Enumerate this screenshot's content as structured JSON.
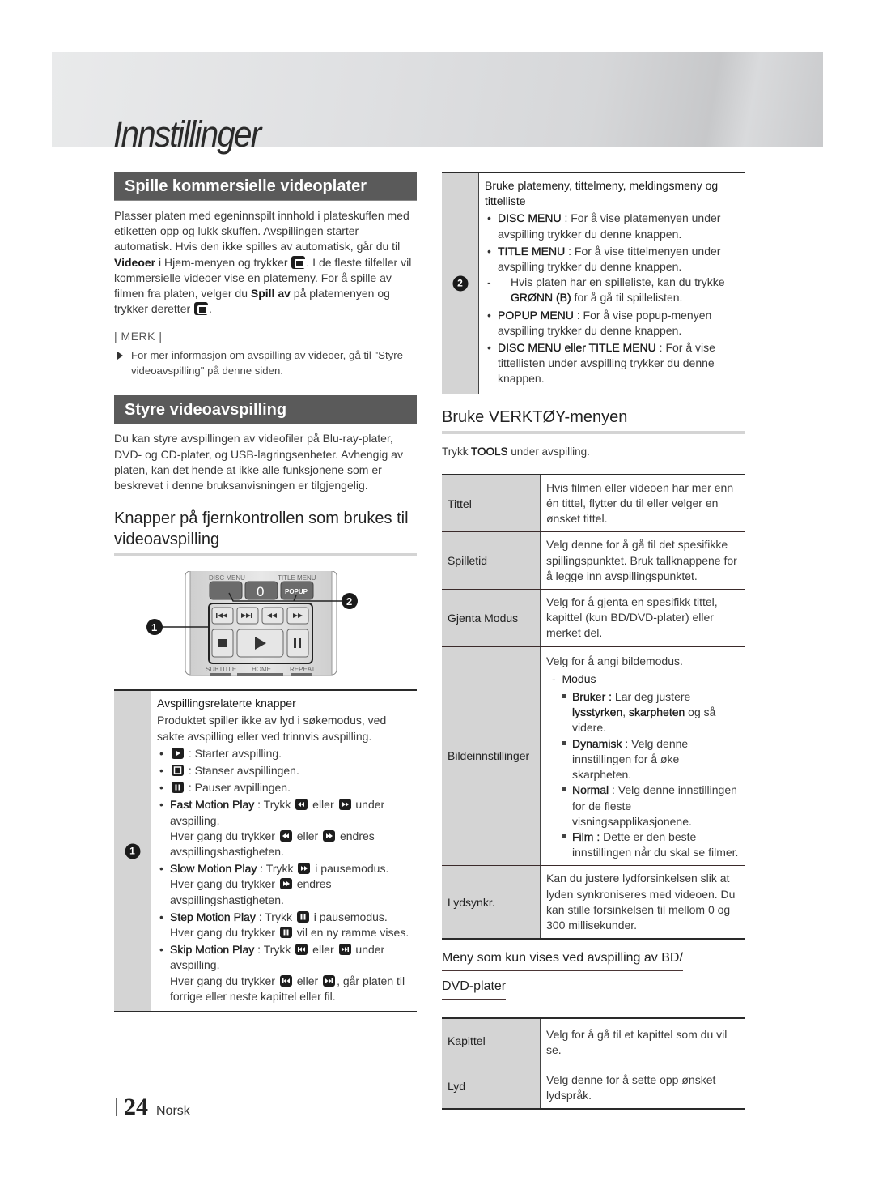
{
  "page": {
    "title": "Innstillinger",
    "page_number": "24",
    "language": "Norsk"
  },
  "left": {
    "section1": {
      "heading": "Spille kommersielle videoplater",
      "para": [
        {
          "t": "Plasser platen med egeninnspilt innhold i plateskuffen med etiketten opp og lukk skuffen. Avspillingen starter automatisk. Hvis den ikke spilles av automatisk, går du til "
        },
        {
          "b": "Videoer"
        },
        {
          "t": " i Hjem-menyen og trykker "
        },
        {
          "icon": "enter"
        },
        {
          "t": ". I de fleste tilfeller vil kommersielle videoer vise en platemeny. For å spille av filmen fra platen, velger du "
        },
        {
          "b": "Spill av"
        },
        {
          "t": " på platemenyen og trykker deretter "
        },
        {
          "icon": "enter"
        },
        {
          "t": "."
        }
      ],
      "merk_label": "| MERK |",
      "note": "For mer informasjon om avspilling av videoer, gå til \"Styre videoavspilling\" på denne siden."
    },
    "section2": {
      "heading": "Styre videoavspilling",
      "para": "Du kan styre avspillingen av videofiler på Blu-ray-plater, DVD- og CD-plater, og USB-lagringsenheter. Avhengig av platen, kan det hende at ikke alle funksjonene som er beskrevet i denne bruksanvisningen er tilgjengelig.",
      "subheading": "Knapper på fjernkontrollen som brukes til videoavspilling"
    },
    "remote": {
      "labels": {
        "disc_menu": "DISC MENU",
        "title_menu": "TITLE MENU",
        "zero": "0",
        "popup": "POPUP",
        "subtitle": "SUBTITLE",
        "home": "HOME",
        "repeat": "REPEAT"
      },
      "callout1": "1",
      "callout2": "2"
    },
    "table": {
      "num": "1",
      "title": "Avspillingsrelaterte knapper",
      "intro": "Produktet spiller ikke av lyd i søkemodus, ved sakte avspilling eller ved trinnvis avspilling.",
      "play": ": Starter avspilling.",
      "stop": ": Stanser avspillingen.",
      "pause": ": Pauser avpillingen.",
      "fast": {
        "name": "Fast Motion Play",
        "a": " : Trykk ",
        "b": " eller ",
        "c": " under avspilling.",
        "d": "Hver gang du trykker ",
        "e": " eller ",
        "f": " endres avspillingshastigheten."
      },
      "slow": {
        "name": "Slow Motion Play",
        "a": " : Trykk ",
        "b": " i pausemodus.",
        "c": "Hver gang du trykker ",
        "d": " endres avspillingshastigheten."
      },
      "step": {
        "name": "Step Motion Play",
        "a": " : Trykk ",
        "b": " i pausemodus.",
        "c": "Hver gang du trykker ",
        "d": " vil en ny ramme vises."
      },
      "skip": {
        "name": "Skip Motion Play",
        "a": " : Trykk ",
        "b": " eller ",
        "c": " under avspilling.",
        "d": "Hver gang du trykker ",
        "e": " eller ",
        "f": ", går platen til forrige eller neste kapittel eller fil."
      }
    }
  },
  "right": {
    "table2": {
      "num": "2",
      "title": "Bruke platemeny, tittelmeny, meldingsmeny og tittelliste",
      "disc": {
        "name": "DISC MENU",
        "text": " : For å vise platemenyen under avspilling trykker du denne knappen."
      },
      "titlemenu": {
        "name": "TITLE MENU",
        "text": " : For å vise tittelmenyen under avspilling trykker du denne knappen."
      },
      "sub": {
        "a": "Hvis platen har en spilleliste, kan du trykke ",
        "b": "GRØNN (B)",
        "c": " for å gå til spillelisten."
      },
      "popup": {
        "name": "POPUP MENU",
        "text": " : For å vise popup-menyen avspilling trykker du denne knappen."
      },
      "either": {
        "name": "DISC MENU eller TITLE MENU",
        "text": " : For å vise tittellisten under avspilling trykker du denne knappen."
      }
    },
    "tools": {
      "heading": "Bruke VERKTØY-menyen",
      "intro_a": "Trykk ",
      "intro_b": "TOOLS",
      "intro_c": " under avspilling.",
      "rows": [
        {
          "label": "Tittel",
          "desc": "Hvis filmen eller videoen har mer enn én tittel, flytter du til eller velger en ønsket tittel."
        },
        {
          "label": "Spilletid",
          "desc": "Velg denne for å gå til det spesifikke spillingspunktet. Bruk tallknappene for å legge inn avspillingspunktet."
        },
        {
          "label": "Gjenta Modus",
          "desc": "Velg for å gjenta en spesifikk tittel, kapittel (kun BD/DVD-plater) eller merket del."
        }
      ],
      "picture": {
        "label": "Bildeinnstillinger",
        "intro": "Velg for å angi bildemodus.",
        "modus": "Modus",
        "bruker": {
          "name": "Bruker :",
          "a": " Lar deg justere ",
          "b": "lysstyrken",
          "c": ", ",
          "d": "skarpheten",
          "e": " og så videre."
        },
        "dynamisk": {
          "name": "Dynamisk",
          "text": " : Velg denne innstillingen for å øke skarpheten."
        },
        "normal": {
          "name": "Normal",
          "text": " : Velg denne innstillingen for de fleste visningsapplikasjonene."
        },
        "film": {
          "name": "Film :",
          "text": " Dette er den beste innstillingen når du skal se filmer."
        }
      },
      "lydsynkr": {
        "label": "Lydsynkr.",
        "desc": "Kan du justere lydforsinkelsen slik at lyden synkroniseres med videoen. Du kan stille forsinkelsen til mellom 0 og 300 millisekunder."
      }
    },
    "bd": {
      "heading_line1": "Meny som kun vises ved avspilling av BD/",
      "heading_line2": "DVD-plater",
      "rows": [
        {
          "label": "Kapittel",
          "desc": "Velg for å gå til et kapittel som du vil se."
        },
        {
          "label": "Lyd",
          "desc": "Velg denne for å sette opp ønsket lydspråk."
        }
      ]
    }
  }
}
